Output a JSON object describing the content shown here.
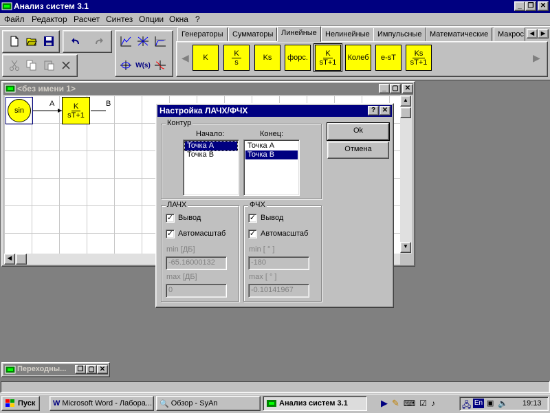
{
  "app": {
    "title": "Анализ систем 3.1",
    "controls": {
      "minimize": "_",
      "restore": "❐",
      "close": "✕"
    }
  },
  "menu": [
    "Файл",
    "Редактор",
    "Расчет",
    "Синтез",
    "Опции",
    "Окна",
    "?"
  ],
  "toolbar": {
    "file_icons": [
      "new-file-icon",
      "open-folder-icon",
      "save-disk-icon"
    ],
    "undo_icons": [
      "undo-icon",
      "redo-icon"
    ],
    "edit_icons": [
      "cut-icon",
      "copy-icon",
      "paste-icon",
      "delete-icon"
    ],
    "analysis_icons": [
      "frequency-response-icon",
      "root-locus-icon",
      "step-response-icon",
      "nyquist-icon",
      "wsz-icon",
      "bode-icon"
    ],
    "wsz_label": "W(s)"
  },
  "palette": {
    "tabs": [
      "Генераторы",
      "Сумматоры",
      "Линейные",
      "Нелинейные",
      "Импульсные",
      "Математические",
      "Макрос"
    ],
    "active_tab": "Линейные",
    "blocks": [
      {
        "num": "K",
        "den": ""
      },
      {
        "num": "K",
        "den": "s"
      },
      {
        "num": "Ks",
        "den": ""
      },
      {
        "num": "форс.",
        "den": ""
      },
      {
        "num": "K",
        "den": "sT+1"
      },
      {
        "num": "Колеб",
        "den": ""
      },
      {
        "num": "e-sT",
        "den": ""
      },
      {
        "num": "Ks",
        "den": "sT+1"
      }
    ],
    "nav_left": "◀",
    "nav_right": "▶",
    "tab_scroll_left": "◀",
    "tab_scroll_right": "▶"
  },
  "doc_window": {
    "title": "<без имени 1>",
    "blocks": {
      "sin": "sin",
      "tf_num": "K",
      "tf_den": "sT+1"
    },
    "labels": {
      "a": "A",
      "b": "B"
    }
  },
  "dialog": {
    "title": "Настройка ЛАЧХ/ФЧХ",
    "help": "?",
    "close": "✕",
    "contour": {
      "group": "Контур",
      "start_label": "Начало:",
      "end_label": "Конец:",
      "start_items": [
        {
          "text": "Точка А",
          "selected": true
        },
        {
          "text": "Точка В",
          "selected": false
        }
      ],
      "end_items": [
        {
          "text": "Точка А",
          "selected": false
        },
        {
          "text": "Точка В",
          "selected": true
        }
      ]
    },
    "lachx": {
      "group": "ЛАЧХ",
      "output_label": "Вывод",
      "output_checked": true,
      "auto_label": "Автомасштаб",
      "auto_checked": true,
      "min_label": "min [ДБ]",
      "min_value": "-65.16000132",
      "max_label": "max [ДБ]",
      "max_value": "0"
    },
    "fchx": {
      "group": "ФЧХ",
      "output_label": "Вывод",
      "output_checked": true,
      "auto_label": "Автомасштаб",
      "auto_checked": true,
      "min_label": "min [ ° ]",
      "min_value": "-180",
      "max_label": "max [ ° ]",
      "max_value": "-0.10141967"
    },
    "ok": "Ok",
    "cancel": "Отмена"
  },
  "minimized_window": {
    "title": "Переходны..."
  },
  "taskbar": {
    "start": "Пуск",
    "tasks": [
      "Microsoft Word - Лабора...",
      "Обзор - SyAn",
      "Анализ систем 3.1"
    ],
    "active_task": "Анализ систем 3.1",
    "lang": "En",
    "time": "19:13"
  },
  "colors": {
    "title_active": "#000080",
    "block_fill": "#ffff00",
    "desktop_area": "#808080",
    "face": "#c0c0c0"
  }
}
